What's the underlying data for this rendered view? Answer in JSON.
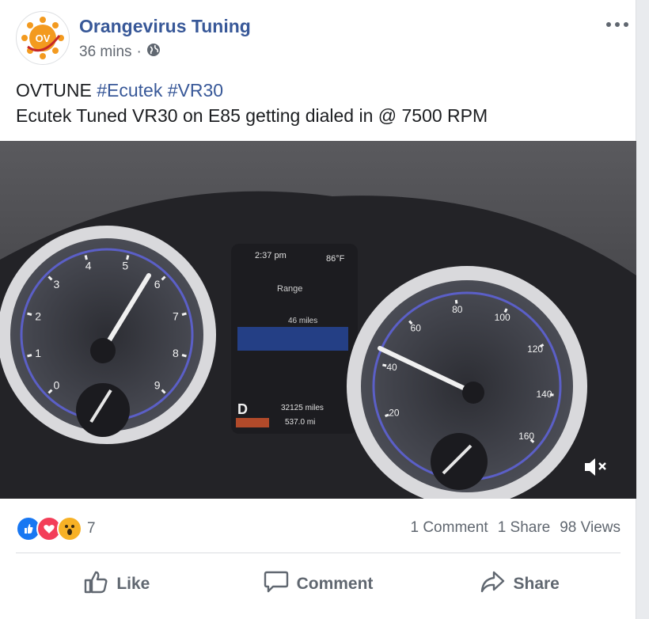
{
  "post": {
    "author": "Orangevirus Tuning",
    "avatar_text": "OV",
    "time": "36 mins",
    "time_separator": "·",
    "audience_icon": "globe-icon",
    "more_icon": "more-options-icon",
    "text": {
      "prefix": "OVTUNE",
      "hashtag1": "#Ecutek",
      "hashtag2": "#VR30",
      "line2": "Ecutek Tuned VR30 on E85 getting dialed in @ 7500 RPM"
    }
  },
  "video": {
    "mute_icon": "speaker-muted-icon",
    "tach_labels": [
      "0",
      "1",
      "2",
      "3",
      "4",
      "5",
      "6",
      "7",
      "8",
      "9"
    ],
    "speedo_labels": [
      "20",
      "40",
      "60",
      "80",
      "100",
      "120",
      "140",
      "160"
    ],
    "cluster_time": "2:37 pm",
    "cluster_temp": "86°F",
    "cluster_range_label": "Range",
    "cluster_range_value": "46 miles",
    "gear": "D",
    "odometer": "32125 miles",
    "trip": "537.0 mi"
  },
  "stats": {
    "reaction_icons": [
      "like-reaction-icon",
      "love-reaction-icon",
      "wow-reaction-icon"
    ],
    "reaction_count": "7",
    "comments": "1 Comment",
    "shares": "1 Share",
    "views": "98 Views"
  },
  "actions": {
    "like": "Like",
    "comment": "Comment",
    "share": "Share"
  },
  "colors": {
    "link": "#385898",
    "like_blue": "#1877f2",
    "love_red": "#f33e58",
    "wow_yellow": "#f7b125",
    "secondary_text": "#606770"
  }
}
